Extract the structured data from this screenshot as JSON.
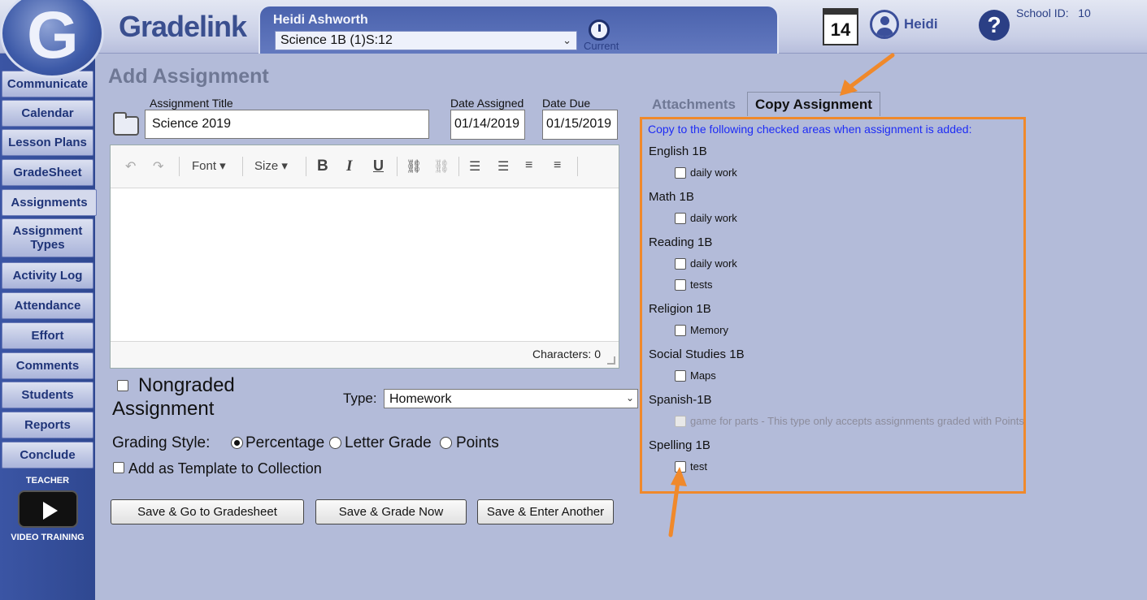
{
  "header": {
    "brand": "Gradelink",
    "teacher_name": "Heidi Ashworth",
    "class_selected": "Science 1B (1)S:12",
    "current_label": "Current",
    "calendar_day": "14",
    "user_name": "Heidi",
    "help_glyph": "?",
    "school_id_label": "School ID:",
    "school_id": "10",
    "icons": [
      "gradelink-logo",
      "clock-icon",
      "calendar-icon",
      "user-icon",
      "help-icon"
    ]
  },
  "sidebar": {
    "items": [
      {
        "label": "Communicate"
      },
      {
        "label": "Calendar"
      },
      {
        "label": "Lesson Plans"
      },
      {
        "label": "GradeSheet"
      },
      {
        "label": "Assignments"
      },
      {
        "label": "Assignment Types"
      },
      {
        "label": "Activity Log"
      },
      {
        "label": "Attendance"
      },
      {
        "label": "Effort"
      },
      {
        "label": "Comments"
      },
      {
        "label": "Students"
      },
      {
        "label": "Reports"
      },
      {
        "label": "Conclude"
      }
    ],
    "active": "Assignments",
    "video_top": "TEACHER",
    "video_bottom": "VIDEO TRAINING"
  },
  "form": {
    "page_title": "Add Assignment",
    "title_label": "Assignment Title",
    "title_value": "Science 2019",
    "date_assigned_label": "Date Assigned",
    "date_assigned_value": "01/14/2019",
    "date_due_label": "Date Due",
    "date_due_value": "01/15/2019",
    "editor": {
      "font_label": "Font",
      "size_label": "Size",
      "characters_label": "Characters: 0"
    },
    "nongraded_line1": "Nongraded",
    "nongraded_line2": "Assignment",
    "type_label": "Type:",
    "type_value": "Homework",
    "grading_style_label": "Grading Style:",
    "grading_options": [
      "Percentage",
      "Letter Grade",
      "Points"
    ],
    "grading_selected": "Percentage",
    "template_label": "Add as Template to Collection",
    "buttons": {
      "save_gradesheet": "Save & Go to Gradesheet",
      "save_grade_now": "Save & Grade Now",
      "save_enter_another": "Save & Enter Another"
    }
  },
  "copy_panel": {
    "tab_attachments": "Attachments",
    "tab_copy": "Copy Assignment",
    "header": "Copy to the following checked areas when assignment is added:",
    "groups": [
      {
        "name": "English 1B",
        "items": [
          "daily work"
        ]
      },
      {
        "name": "Math 1B",
        "items": [
          "daily work"
        ]
      },
      {
        "name": "Reading 1B",
        "items": [
          "daily work",
          "tests"
        ]
      },
      {
        "name": "Religion 1B",
        "items": [
          "Memory"
        ]
      },
      {
        "name": "Social Studies 1B",
        "items": [
          "Maps"
        ]
      },
      {
        "name": "Spanish-1B",
        "items": [
          "game for parts - This type only accepts assignments graded with Points"
        ]
      },
      {
        "name": "Spelling 1B",
        "items": [
          "test"
        ]
      }
    ]
  },
  "colors": {
    "highlight_orange": "#f0892b",
    "link_blue": "#1e2cf5",
    "sidebar_blue": "#2f4891"
  }
}
